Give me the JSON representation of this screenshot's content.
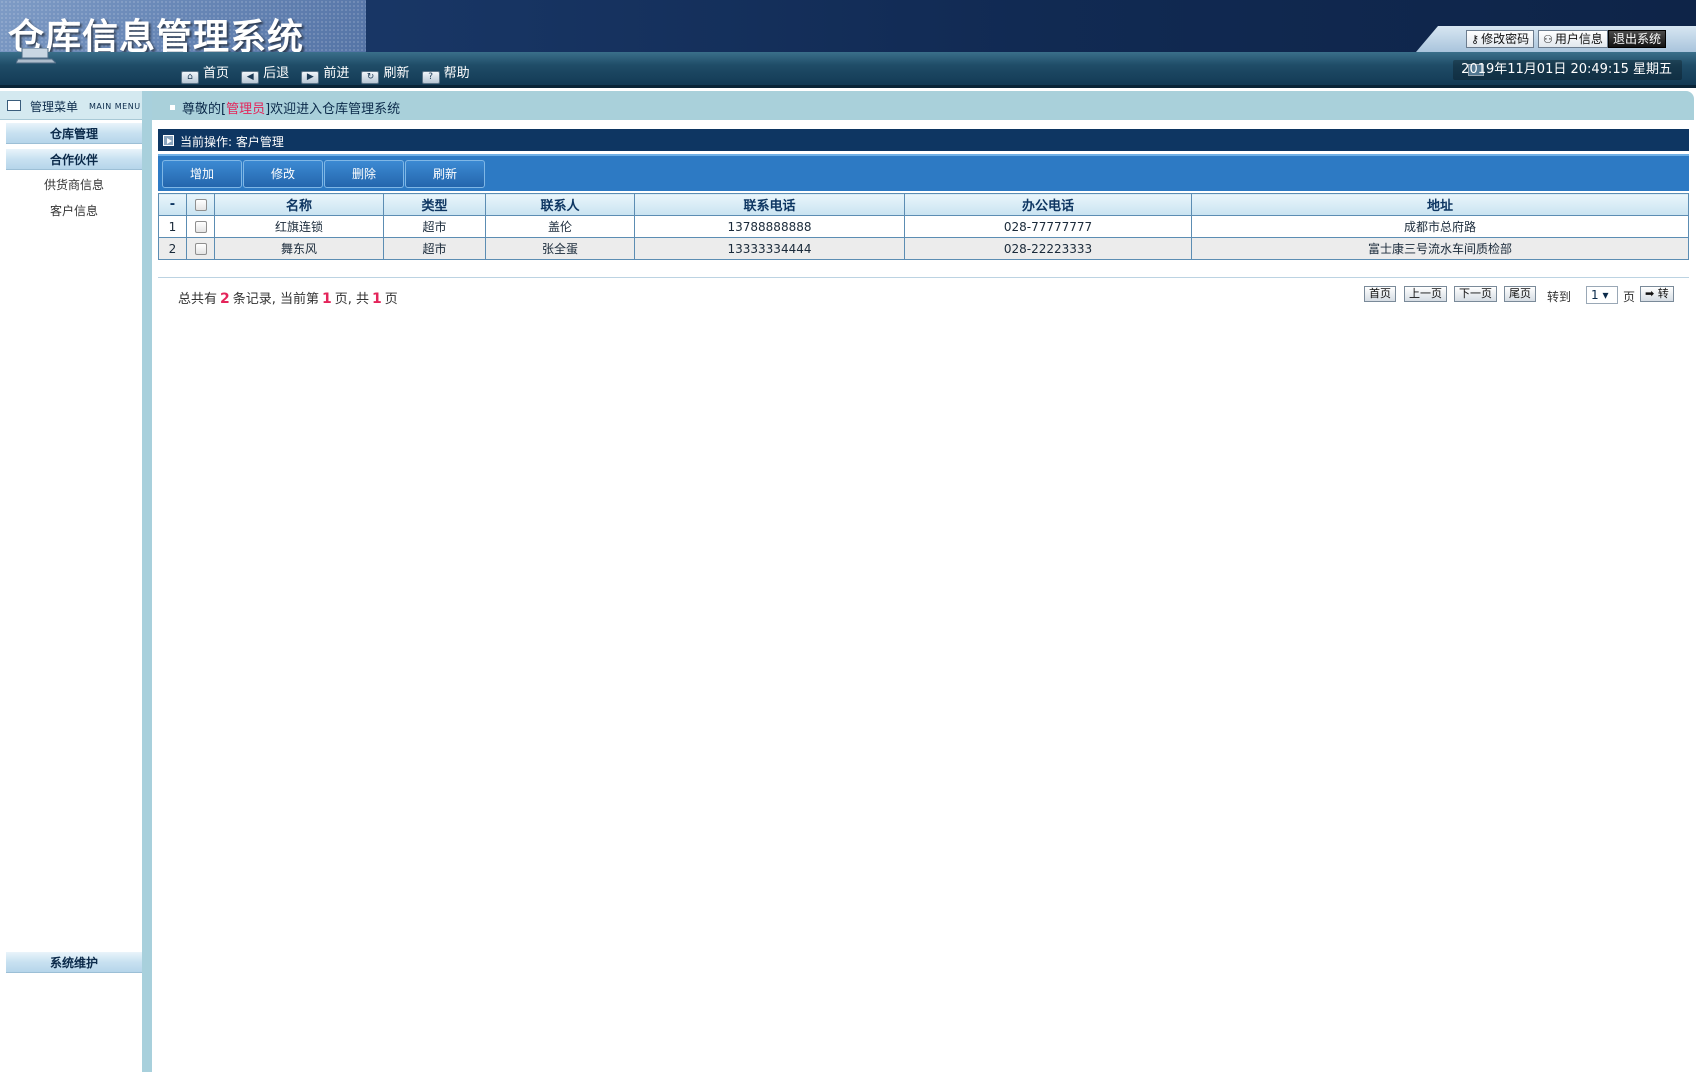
{
  "header": {
    "app_title": "仓库信息管理系统",
    "tools": {
      "change_password": "修改密码",
      "user_info": "用户信息",
      "logout": "退出系统"
    }
  },
  "toolbar": {
    "nav": [
      {
        "label": "首页",
        "icon": "home-icon"
      },
      {
        "label": "后退",
        "icon": "back-arrow-icon"
      },
      {
        "label": "前进",
        "icon": "forward-arrow-icon"
      },
      {
        "label": "刷新",
        "icon": "refresh-icon"
      },
      {
        "label": "帮助",
        "icon": "help-icon"
      }
    ],
    "datetime": "2019年11月01日 20:49:15 星期五"
  },
  "sidebar": {
    "title": "管理菜单",
    "title_en": "MAIN MENU",
    "groups": [
      {
        "label": "仓库管理"
      },
      {
        "label": "合作伙伴",
        "items": [
          "供货商信息",
          "客户信息"
        ]
      },
      {
        "label": "系统维护"
      }
    ]
  },
  "welcome": {
    "prefix": "尊敬的[",
    "role": "管理员",
    "suffix": "]欢迎进入仓库管理系统"
  },
  "operation": {
    "label": "当前操作:",
    "current": "客户管理"
  },
  "actions": {
    "add": "增加",
    "edit": "修改",
    "delete": "删除",
    "refresh": "刷新"
  },
  "table": {
    "columns": [
      "-",
      "",
      "名称",
      "类型",
      "联系人",
      "联系电话",
      "办公电话",
      "地址"
    ],
    "rows": [
      {
        "index": "1",
        "name": "红旗连锁",
        "type": "超市",
        "contact": "盖伦",
        "phone": "13788888888",
        "office_phone": "028-77777777",
        "address": "成都市总府路"
      },
      {
        "index": "2",
        "name": "舞东风",
        "type": "超市",
        "contact": "张全蛋",
        "phone": "13333334444",
        "office_phone": "028-22223333",
        "address": "富士康三号流水车间质检部"
      }
    ]
  },
  "pager": {
    "summary_1": "总共有",
    "total_records": "2",
    "summary_2": "条记录, 当前第",
    "current_page": "1",
    "summary_3": "页, 共",
    "total_pages": "1",
    "summary_4": "页",
    "first": "首页",
    "prev": "上一页",
    "next": "下一页",
    "last": "尾页",
    "goto_label": "转到",
    "selected_page": "1 ▾",
    "page_unit": "页",
    "go": "➡ 转"
  }
}
